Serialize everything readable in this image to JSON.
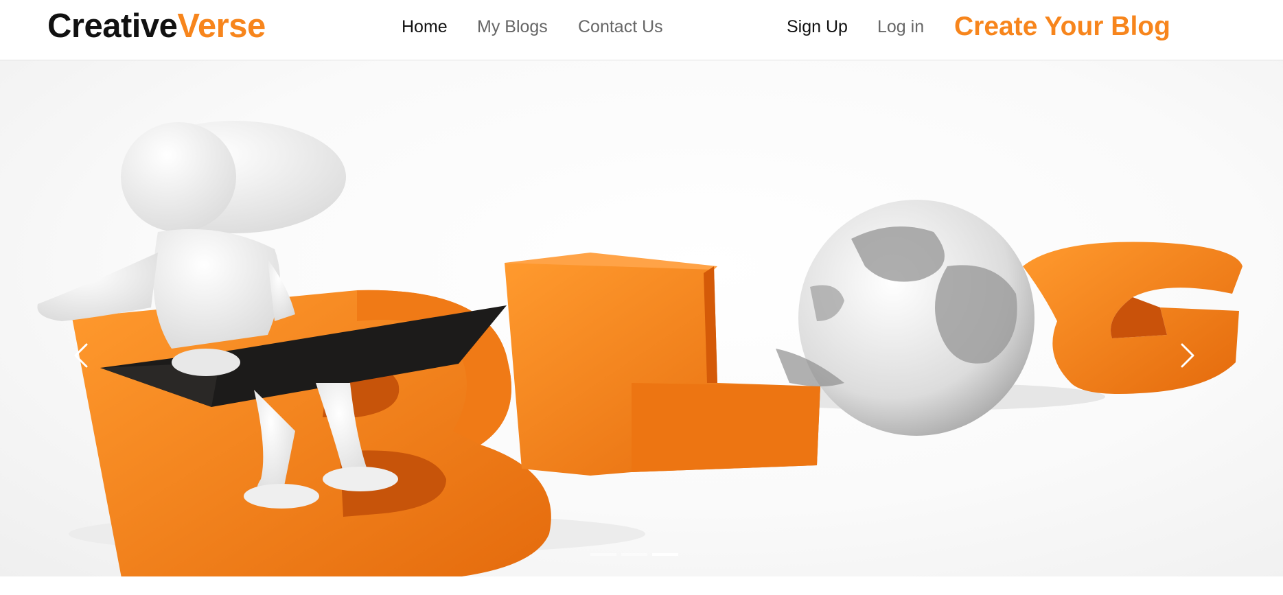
{
  "brand": {
    "part1": "Creative",
    "part2": "Verse",
    "accent_color": "#f7851c"
  },
  "nav": {
    "home": "Home",
    "my_blogs": "My Blogs",
    "contact": "Contact Us",
    "sign_up": "Sign Up",
    "log_in": "Log in",
    "cta": "Create Your Blog"
  },
  "carousel": {
    "slide_count": 3,
    "active_slide": 3,
    "prev_icon": "chevron-left-icon",
    "next_icon": "chevron-right-icon"
  }
}
